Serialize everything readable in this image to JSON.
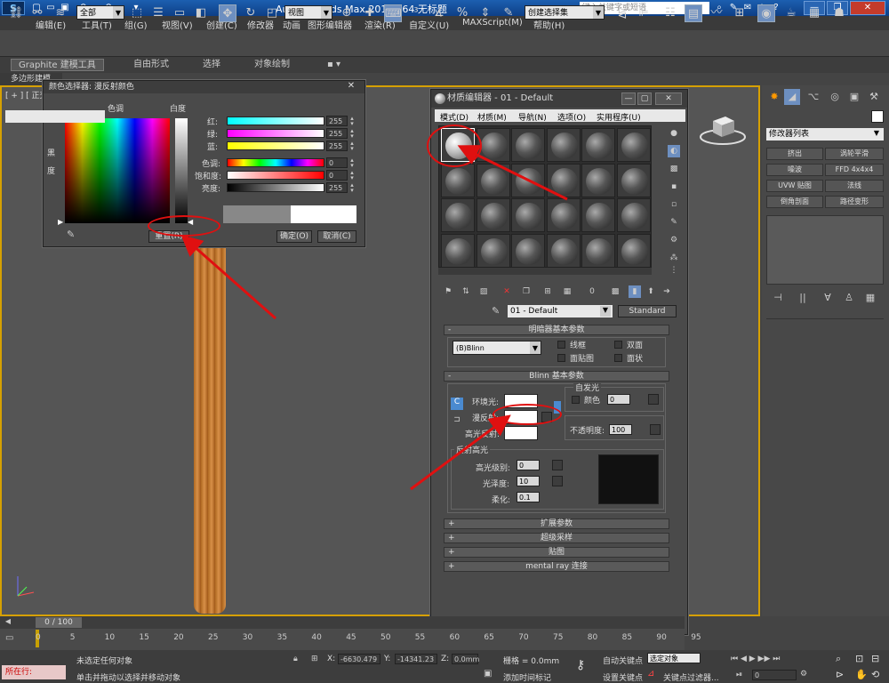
{
  "titlebar": {
    "app_title": "Autodesk 3ds Max  2012 x64     无标题",
    "search_placeholder": "键入关键字或短语",
    "min": "—",
    "max": "❐",
    "close": "✕"
  },
  "menu": [
    "编辑(E)",
    "工具(T)",
    "组(G)",
    "视图(V)",
    "创建(C)",
    "修改器",
    "动画",
    "图形编辑器",
    "渲染(R)",
    "自定义(U)",
    "MAXScript(M)",
    "帮助(H)"
  ],
  "toolbar": {
    "selection_filter": "全部",
    "ref_coord": "视图",
    "named_selection": "创建选择集"
  },
  "ribbon": {
    "tabs": [
      "Graphite 建模工具",
      "自由形式",
      "选择",
      "对象绘制"
    ],
    "sub": "多边形建模"
  },
  "viewport": {
    "label": "[ + ] [ 正交 ]"
  },
  "color_dialog": {
    "title": "颜色选择器: 漫反射颜色",
    "hue_label": "色调",
    "whiteness_label": "白度",
    "black_label": "黑",
    "degree_label": "度",
    "rows": [
      {
        "label": "红:",
        "value": "255"
      },
      {
        "label": "绿:",
        "value": "255"
      },
      {
        "label": "蓝:",
        "value": "255"
      },
      {
        "label": "色调:",
        "value": "0"
      },
      {
        "label": "饱和度:",
        "value": "0"
      },
      {
        "label": "亮度:",
        "value": "255"
      }
    ],
    "reset_button": "重置(R)",
    "ok_button": "确定(O)",
    "cancel_button": "取消(C)"
  },
  "material_editor": {
    "title": "材质编辑器 - 01 - Default",
    "menu": [
      "模式(D)",
      "材质(M)",
      "导航(N)",
      "选项(O)",
      "实用程序(U)"
    ],
    "material_name": "01 - Default",
    "material_type": "Standard",
    "shader_rollout": "明暗器基本参数",
    "shader": "(B)Blinn",
    "shader_options": [
      "线框",
      "双面",
      "面贴图",
      "面状"
    ],
    "blinn_rollout": "Blinn 基本参数",
    "self_illum": "自发光",
    "color_label": "颜色",
    "self_illum_value": "0",
    "ambient_label": "环境光:",
    "diffuse_label": "漫反射:",
    "specular_label": "高光反射:",
    "opacity_label": "不透明度:",
    "opacity_value": "100",
    "spec_highlights": "反射高光",
    "spec_level_label": "高光级别:",
    "spec_level_value": "0",
    "glossiness_label": "光泽度:",
    "glossiness_value": "10",
    "soften_label": "柔化:",
    "soften_value": "0.1",
    "rollouts": [
      "扩展参数",
      "超级采样",
      "贴图",
      "mental ray 连接"
    ]
  },
  "command_panel": {
    "modifier_list": "修改器列表",
    "buttons": [
      "挤出",
      "涡轮平滑",
      "噪波",
      "FFD 4x4x4",
      "UVW 贴图",
      "法线",
      "倒角剖面",
      "路径变形"
    ]
  },
  "timeline": {
    "frame": "0 / 100",
    "ticks": [
      "0",
      "5",
      "10",
      "15",
      "20",
      "25",
      "30",
      "35",
      "40",
      "45",
      "50",
      "55",
      "60",
      "65",
      "70",
      "75",
      "80",
      "85",
      "90",
      "95"
    ]
  },
  "status": {
    "running": "所在行:",
    "line1": "未选定任何对象",
    "line2": "单击并拖动以选择并移动对象",
    "x_label": "X:",
    "x_value": "-6630.479",
    "y_label": "Y:",
    "y_value": "-14341.23",
    "z_label": "Z:",
    "z_value": "0.0mm",
    "grid": "栅格 = 0.0mm",
    "auto_key": "自动关键点",
    "auto_key_target": "选定对象",
    "set_key": "设置关键点",
    "key_filters": "关键点过滤器...",
    "add_time_tag": "添加时间标记",
    "frame_field": "0"
  }
}
